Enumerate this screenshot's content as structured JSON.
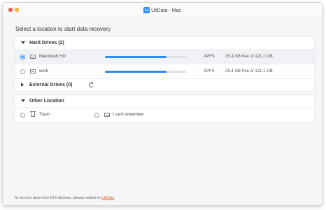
{
  "window": {
    "title": "UltData - Mac",
    "app_icon": "ultdata-logo-icon"
  },
  "heading": "Select a location to start data recovery",
  "hard_drives": {
    "title": "Hard Drives (2)",
    "items": [
      {
        "name": "Macintosh HD",
        "fs": "APFS",
        "free": "25.4 GB free of 121.1 GB",
        "usage": 0.76,
        "selected": true
      },
      {
        "name": "work",
        "fs": "APFS",
        "free": "25.4 GB free of 121.1 GB",
        "usage": 0.76,
        "selected": false
      }
    ]
  },
  "external_drives": {
    "title": "External Drives (0)"
  },
  "other_location": {
    "title": "Other Location",
    "items": [
      {
        "name": "Trash"
      },
      {
        "name": "I can't remember"
      }
    ]
  },
  "footer": {
    "text": "To recover data from iOS devices, please switch to",
    "link": "UltData"
  },
  "colors": {
    "accent": "#2f8cf3",
    "link": "#e8692c"
  }
}
